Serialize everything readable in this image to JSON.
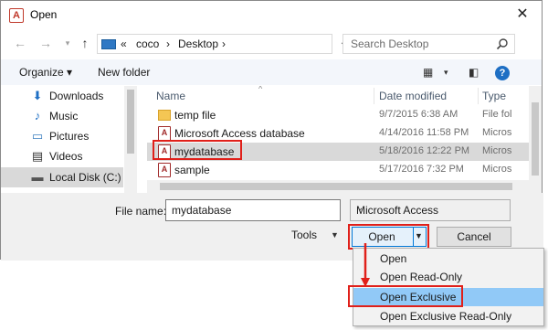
{
  "window": {
    "title": "Open",
    "app_icon": "access-icon"
  },
  "nav": {
    "breadcrumb": [
      "«",
      "coco",
      "›",
      "Desktop",
      "›"
    ],
    "search_placeholder": "Search Desktop"
  },
  "toolbar": {
    "organize_label": "Organize ▾",
    "new_folder_label": "New folder"
  },
  "sidebar": {
    "items": [
      {
        "label": "Downloads",
        "icon": "download-arrow-icon"
      },
      {
        "label": "Music",
        "icon": "music-note-icon"
      },
      {
        "label": "Pictures",
        "icon": "pictures-icon"
      },
      {
        "label": "Videos",
        "icon": "film-icon"
      },
      {
        "label": "Local Disk (C:)",
        "icon": "disk-icon"
      }
    ]
  },
  "files": {
    "columns": [
      "Name",
      "Date modified",
      "Type"
    ],
    "rows": [
      {
        "name": "temp file",
        "date": "9/7/2015 6:38 AM",
        "type": "File fol",
        "icon": "folder-icon"
      },
      {
        "name": "Microsoft Access database",
        "date": "4/14/2016 11:58 PM",
        "type": "Micros",
        "icon": "access-file-icon"
      },
      {
        "name": "mydatabase",
        "date": "5/18/2016 12:22 PM",
        "type": "Micros",
        "icon": "access-file-icon"
      },
      {
        "name": "sample",
        "date": "5/17/2016 7:32 PM",
        "type": "Micros",
        "icon": "access-file-icon"
      }
    ]
  },
  "footer": {
    "file_name_label": "File name:",
    "file_name_value": "mydatabase",
    "filter_value": "Microsoft Access",
    "tools_label": "Tools",
    "open_label": "Open",
    "cancel_label": "Cancel"
  },
  "open_menu": {
    "items": [
      "Open",
      "Open Read-Only",
      "Open Exclusive",
      "Open Exclusive Read-Only"
    ]
  },
  "colors": {
    "highlight": "#e0201a",
    "menu_hover": "#91c9f7",
    "accent": "#0078d7"
  }
}
